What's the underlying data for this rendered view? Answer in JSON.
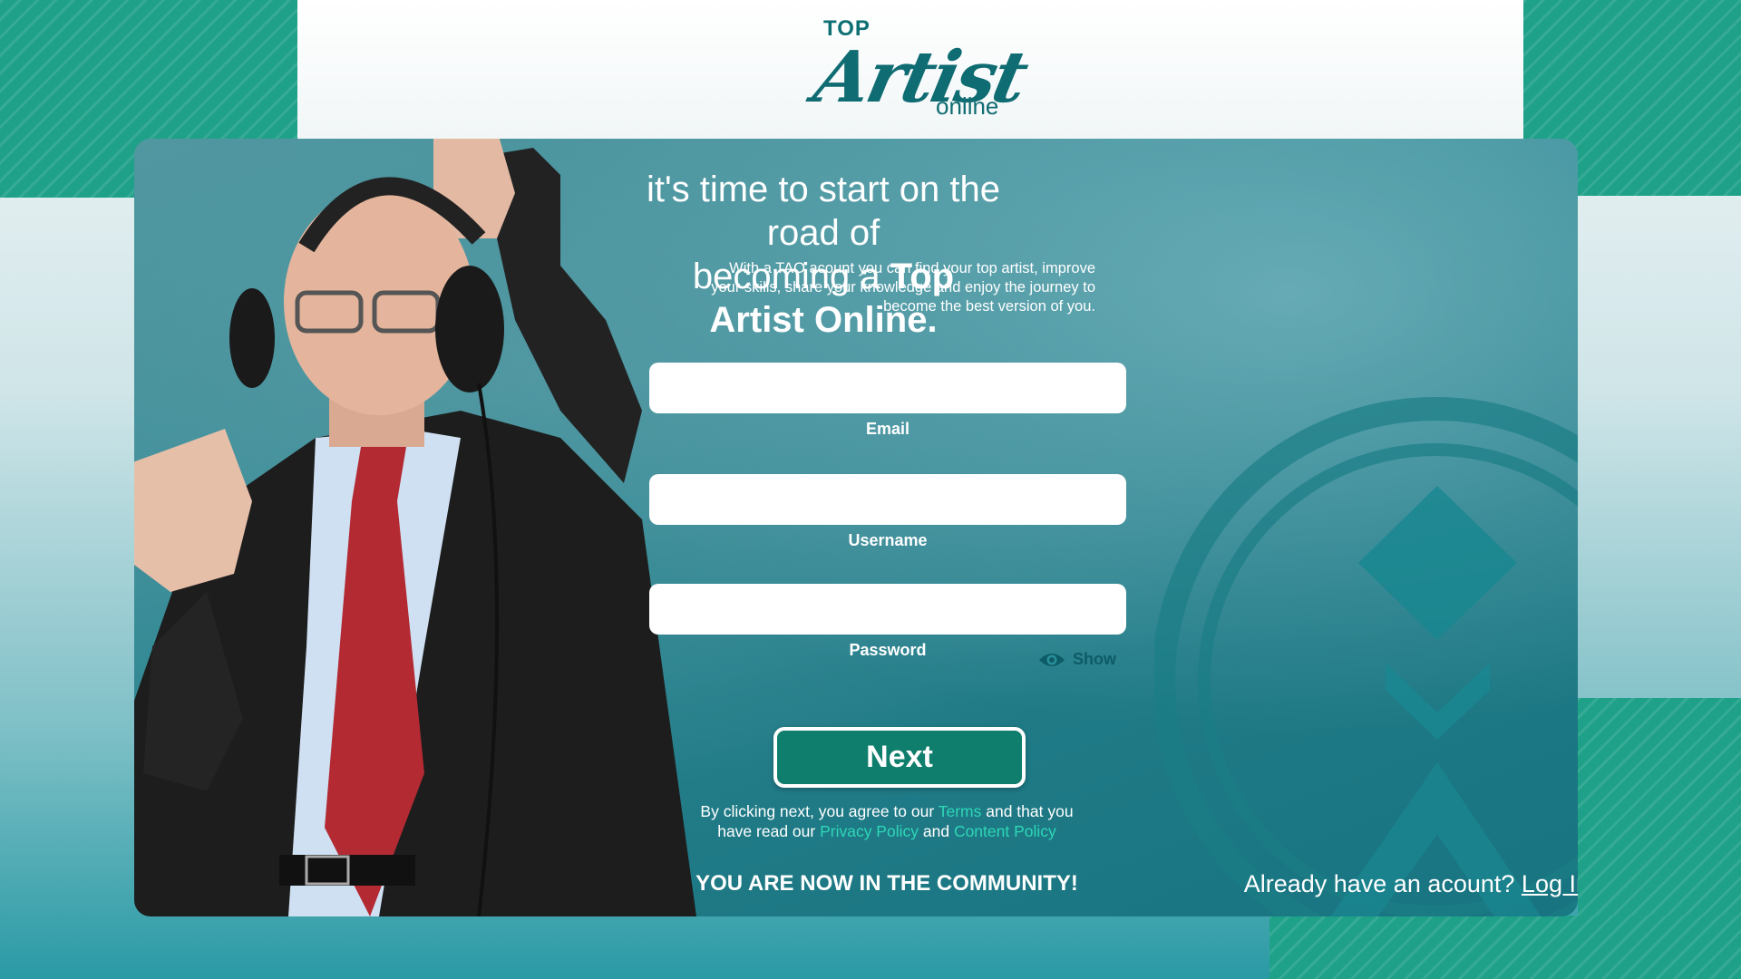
{
  "logo": {
    "top": "TOP",
    "artist": "Artist",
    "online": "online"
  },
  "headline": {
    "line1": "it's time to start on the road of",
    "line2_prefix": "becoming a ",
    "line2_bold": "Top Artist Online."
  },
  "subtext": "With a TAO acount you can find your top artist, improve your skills, share your knowledge and enjoy the journey to become the best version of you.",
  "form": {
    "email": {
      "label": "Email",
      "value": "",
      "placeholder": ""
    },
    "username": {
      "label": "Username",
      "value": "",
      "placeholder": ""
    },
    "password": {
      "label": "Password",
      "value": "",
      "placeholder": ""
    },
    "show_label": "Show",
    "next_label": "Next"
  },
  "legal": {
    "p1": "By clicking next, you agree to our ",
    "terms": "Terms",
    "p2": " and that you have read our ",
    "privacy": "Privacy  Policy",
    "p3": " and ",
    "content": "Content Policy"
  },
  "community": "YOU ARE NOW IN THE COMMUNITY!",
  "login": {
    "prompt": "Already have an acount? ",
    "link": "Log In"
  },
  "colors": {
    "accent": "#0f7e6c",
    "brand_teal": "#1fa189",
    "link": "#2ed7b6",
    "dark_teal": "#0f6c72"
  },
  "icons": {
    "show": "eye-icon"
  }
}
